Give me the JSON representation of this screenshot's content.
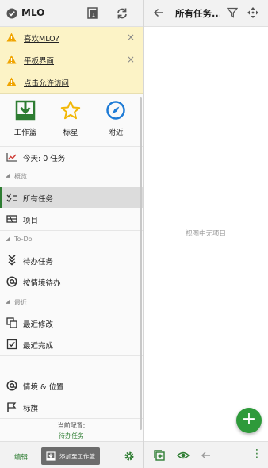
{
  "colors": {
    "accent": "#2e7d32",
    "fab": "#2e9a3a",
    "notice_bg": "#fcf3c6",
    "warning": "#f0a400",
    "star": "#f2b705",
    "nearby": "#1e7bd6",
    "today_chart": "#d0403a"
  },
  "left_header": {
    "app_title": "MLO",
    "icons": [
      "app-check-icon",
      "tablet-view-icon",
      "sync-icon"
    ]
  },
  "notices": [
    {
      "text": "喜欢MLO?",
      "icon": "warning-icon",
      "closable": true
    },
    {
      "text": "平板界面",
      "icon": "warning-icon",
      "closable": true
    },
    {
      "text": "点击允许访问",
      "icon": "warning-icon",
      "closable": false
    }
  ],
  "notice_close_glyph": "×",
  "quick_access": [
    {
      "label": "工作篮",
      "icon": "inbox-download-icon"
    },
    {
      "label": "标星",
      "icon": "star-icon"
    },
    {
      "label": "附近",
      "icon": "compass-icon"
    }
  ],
  "today": {
    "text": "今天: 0 任务",
    "icon": "chart-icon"
  },
  "sections": {
    "overview": "概览",
    "todo": "To-Do",
    "recent": "最近"
  },
  "nav": {
    "all_tasks": "所有任务",
    "projects": "项目",
    "pending": "待办任务",
    "by_context": "按情境待办",
    "recently_modified": "最近修改",
    "recently_done": "最近完成",
    "contexts": "情境 & 位置",
    "flags": "标旗"
  },
  "current_config": {
    "label": "当前配置:",
    "value": "待办任务"
  },
  "left_footer": {
    "edit_label": "编辑",
    "add_label": "添加至工作篮"
  },
  "right_header": {
    "title": "所有任务..."
  },
  "right_pane": {
    "empty_text": "视图中无项目"
  },
  "fab": {
    "glyph": "+"
  },
  "right_footer": {
    "more_glyph": "⋮"
  }
}
